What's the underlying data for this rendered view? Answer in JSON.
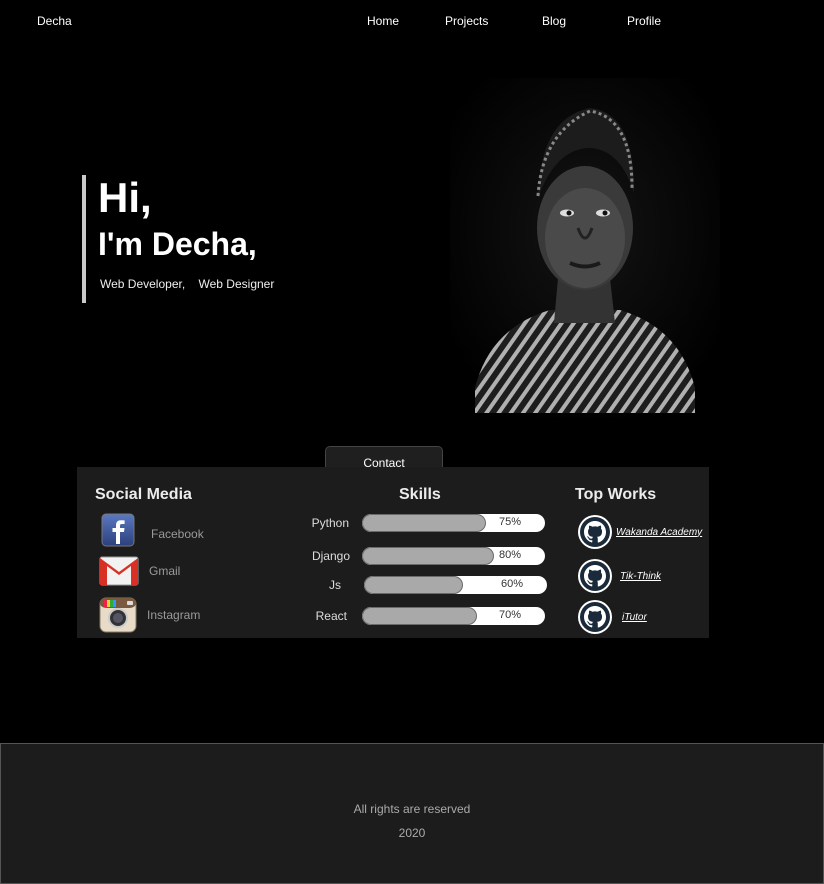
{
  "header": {
    "brand": "Decha",
    "nav": [
      "Home",
      "Projects",
      "Blog",
      "Profile"
    ]
  },
  "hero": {
    "greeting": "Hi,",
    "name": "I'm Decha,",
    "roles": [
      "Web Developer,",
      "Web Designer"
    ]
  },
  "contact_label": "Contact",
  "social": {
    "title": "Social Media",
    "items": [
      {
        "label": "Facebook",
        "icon": "facebook-icon"
      },
      {
        "label": "Gmail",
        "icon": "gmail-icon"
      },
      {
        "label": "Instagram",
        "icon": "instagram-icon"
      }
    ]
  },
  "skills": {
    "title": "Skills",
    "items": [
      {
        "name": "Python",
        "percent": "75%",
        "value": 0.75
      },
      {
        "name": "Django",
        "percent": "80%",
        "value": 0.8
      },
      {
        "name": "Js",
        "percent": "60%",
        "value": 0.6
      },
      {
        "name": "React",
        "percent": "70%",
        "value": 0.7
      }
    ]
  },
  "works": {
    "title": "Top Works",
    "items": [
      {
        "label": "Wakanda Academy",
        "icon": "github-icon"
      },
      {
        "label": "Tik-Think",
        "icon": "github-icon"
      },
      {
        "label": "iTutor",
        "icon": "github-icon"
      }
    ]
  },
  "footer": {
    "line1": "All rights are reserved",
    "line2": "2020"
  }
}
